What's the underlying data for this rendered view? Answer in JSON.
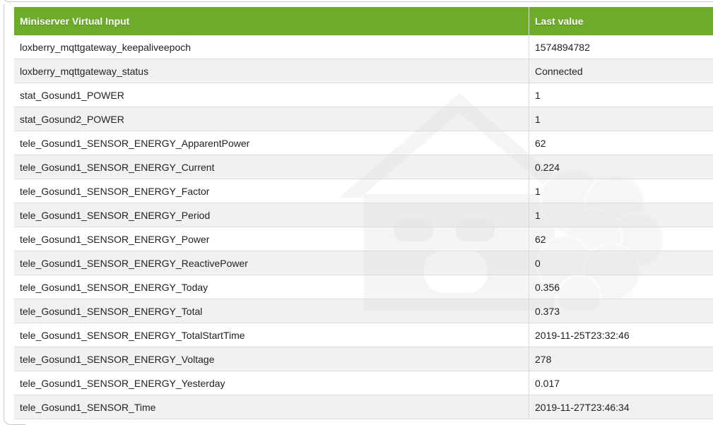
{
  "table": {
    "headers": {
      "name": "Miniserver Virtual Input",
      "value": "Last value"
    },
    "rows": [
      {
        "name": "loxberry_mqttgateway_keepaliveepoch",
        "value": "1574894782"
      },
      {
        "name": "loxberry_mqttgateway_status",
        "value": "Connected"
      },
      {
        "name": "stat_Gosund1_POWER",
        "value": "1"
      },
      {
        "name": "stat_Gosund2_POWER",
        "value": "1"
      },
      {
        "name": "tele_Gosund1_SENSOR_ENERGY_ApparentPower",
        "value": "62"
      },
      {
        "name": "tele_Gosund1_SENSOR_ENERGY_Current",
        "value": "0.224"
      },
      {
        "name": "tele_Gosund1_SENSOR_ENERGY_Factor",
        "value": "1"
      },
      {
        "name": "tele_Gosund1_SENSOR_ENERGY_Period",
        "value": "1"
      },
      {
        "name": "tele_Gosund1_SENSOR_ENERGY_Power",
        "value": "62"
      },
      {
        "name": "tele_Gosund1_SENSOR_ENERGY_ReactivePower",
        "value": "0"
      },
      {
        "name": "tele_Gosund1_SENSOR_ENERGY_Today",
        "value": "0.356"
      },
      {
        "name": "tele_Gosund1_SENSOR_ENERGY_Total",
        "value": "0.373"
      },
      {
        "name": "tele_Gosund1_SENSOR_ENERGY_TotalStartTime",
        "value": "2019-11-25T23:32:46"
      },
      {
        "name": "tele_Gosund1_SENSOR_ENERGY_Voltage",
        "value": "278"
      },
      {
        "name": "tele_Gosund1_SENSOR_ENERGY_Yesterday",
        "value": "0.017"
      },
      {
        "name": "tele_Gosund1_SENSOR_Time",
        "value": "2019-11-27T23:46:34"
      }
    ]
  },
  "colors": {
    "header_bg": "#6dab2a",
    "header_text": "#ffffff",
    "row_even_bg": "#ececec",
    "border": "#dcdcdc"
  },
  "icons": {
    "watermark": "loxberry-logo-watermark"
  }
}
